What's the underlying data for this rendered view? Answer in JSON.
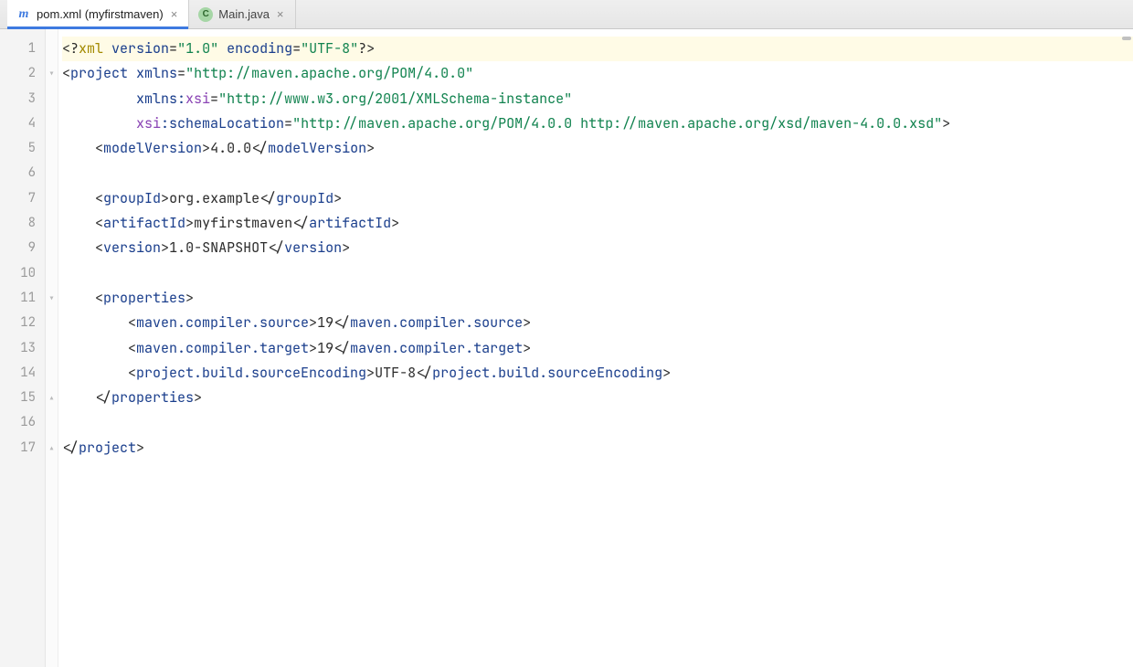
{
  "tabs": [
    {
      "label": "pom.xml (myfirstmaven)",
      "iconKind": "maven",
      "iconGlyph": "m",
      "active": true
    },
    {
      "label": "Main.java",
      "iconKind": "java",
      "iconGlyph": "C",
      "active": false
    }
  ],
  "closeGlyph": "×",
  "lineCount": 17,
  "highlightLine": 1,
  "foldMarkers": {
    "2": "▾",
    "11": "▾",
    "15": "▴",
    "17": "▴"
  },
  "code": [
    [
      {
        "c": "punct",
        "t": "<?"
      },
      {
        "c": "pi",
        "t": "xml "
      },
      {
        "c": "attrname",
        "t": "version"
      },
      {
        "c": "punct",
        "t": "="
      },
      {
        "c": "string",
        "t": "\"1.0\""
      },
      {
        "c": "pi",
        "t": " "
      },
      {
        "c": "attrname",
        "t": "encoding"
      },
      {
        "c": "punct",
        "t": "="
      },
      {
        "c": "string",
        "t": "\"UTF-8\""
      },
      {
        "c": "punct",
        "t": "?>"
      }
    ],
    [
      {
        "c": "punct",
        "t": "<"
      },
      {
        "c": "tagname",
        "t": "project "
      },
      {
        "c": "attrname",
        "t": "xmlns"
      },
      {
        "c": "punct",
        "t": "="
      },
      {
        "c": "string",
        "t": "\"http://maven.apache.org/POM/4.0.0\""
      }
    ],
    [
      {
        "c": "text",
        "t": "         "
      },
      {
        "c": "attrname",
        "t": "xmlns:"
      },
      {
        "c": "nsattr",
        "t": "xsi"
      },
      {
        "c": "punct",
        "t": "="
      },
      {
        "c": "string",
        "t": "\"http://www.w3.org/2001/XMLSchema-instance\""
      }
    ],
    [
      {
        "c": "text",
        "t": "         "
      },
      {
        "c": "nsattr",
        "t": "xsi"
      },
      {
        "c": "attrname",
        "t": ":schemaLocation"
      },
      {
        "c": "punct",
        "t": "="
      },
      {
        "c": "string",
        "t": "\"http://maven.apache.org/POM/4.0.0 http://maven.apache.org/xsd/maven-4.0.0.xsd\""
      },
      {
        "c": "punct",
        "t": ">"
      }
    ],
    [
      {
        "c": "text",
        "t": "    "
      },
      {
        "c": "punct",
        "t": "<"
      },
      {
        "c": "tagname",
        "t": "modelVersion"
      },
      {
        "c": "punct",
        "t": ">"
      },
      {
        "c": "text",
        "t": "4.0.0"
      },
      {
        "c": "punct",
        "t": "</"
      },
      {
        "c": "tagname",
        "t": "modelVersion"
      },
      {
        "c": "punct",
        "t": ">"
      }
    ],
    [],
    [
      {
        "c": "text",
        "t": "    "
      },
      {
        "c": "punct",
        "t": "<"
      },
      {
        "c": "tagname",
        "t": "groupId"
      },
      {
        "c": "punct",
        "t": ">"
      },
      {
        "c": "text",
        "t": "org.example"
      },
      {
        "c": "punct",
        "t": "</"
      },
      {
        "c": "tagname",
        "t": "groupId"
      },
      {
        "c": "punct",
        "t": ">"
      }
    ],
    [
      {
        "c": "text",
        "t": "    "
      },
      {
        "c": "punct",
        "t": "<"
      },
      {
        "c": "tagname",
        "t": "artifactId"
      },
      {
        "c": "punct",
        "t": ">"
      },
      {
        "c": "text",
        "t": "myfirstmaven"
      },
      {
        "c": "punct",
        "t": "</"
      },
      {
        "c": "tagname",
        "t": "artifactId"
      },
      {
        "c": "punct",
        "t": ">"
      }
    ],
    [
      {
        "c": "text",
        "t": "    "
      },
      {
        "c": "punct",
        "t": "<"
      },
      {
        "c": "tagname",
        "t": "version"
      },
      {
        "c": "punct",
        "t": ">"
      },
      {
        "c": "text",
        "t": "1.0-SNAPSHOT"
      },
      {
        "c": "punct",
        "t": "</"
      },
      {
        "c": "tagname",
        "t": "version"
      },
      {
        "c": "punct",
        "t": ">"
      }
    ],
    [],
    [
      {
        "c": "text",
        "t": "    "
      },
      {
        "c": "punct",
        "t": "<"
      },
      {
        "c": "tagname",
        "t": "properties"
      },
      {
        "c": "punct",
        "t": ">"
      }
    ],
    [
      {
        "c": "text",
        "t": "        "
      },
      {
        "c": "punct",
        "t": "<"
      },
      {
        "c": "tagname",
        "t": "maven.compiler.source"
      },
      {
        "c": "punct",
        "t": ">"
      },
      {
        "c": "text",
        "t": "19"
      },
      {
        "c": "punct",
        "t": "</"
      },
      {
        "c": "tagname",
        "t": "maven.compiler.source"
      },
      {
        "c": "punct",
        "t": ">"
      }
    ],
    [
      {
        "c": "text",
        "t": "        "
      },
      {
        "c": "punct",
        "t": "<"
      },
      {
        "c": "tagname",
        "t": "maven.compiler.target"
      },
      {
        "c": "punct",
        "t": ">"
      },
      {
        "c": "text",
        "t": "19"
      },
      {
        "c": "punct",
        "t": "</"
      },
      {
        "c": "tagname",
        "t": "maven.compiler.target"
      },
      {
        "c": "punct",
        "t": ">"
      }
    ],
    [
      {
        "c": "text",
        "t": "        "
      },
      {
        "c": "punct",
        "t": "<"
      },
      {
        "c": "tagname",
        "t": "project.build.sourceEncoding"
      },
      {
        "c": "punct",
        "t": ">"
      },
      {
        "c": "text",
        "t": "UTF-8"
      },
      {
        "c": "punct",
        "t": "</"
      },
      {
        "c": "tagname",
        "t": "project.build.sourceEncoding"
      },
      {
        "c": "punct",
        "t": ">"
      }
    ],
    [
      {
        "c": "text",
        "t": "    "
      },
      {
        "c": "punct",
        "t": "</"
      },
      {
        "c": "tagname",
        "t": "properties"
      },
      {
        "c": "punct",
        "t": ">"
      }
    ],
    [],
    [
      {
        "c": "punct",
        "t": "</"
      },
      {
        "c": "tagname",
        "t": "project"
      },
      {
        "c": "punct",
        "t": ">"
      }
    ]
  ]
}
